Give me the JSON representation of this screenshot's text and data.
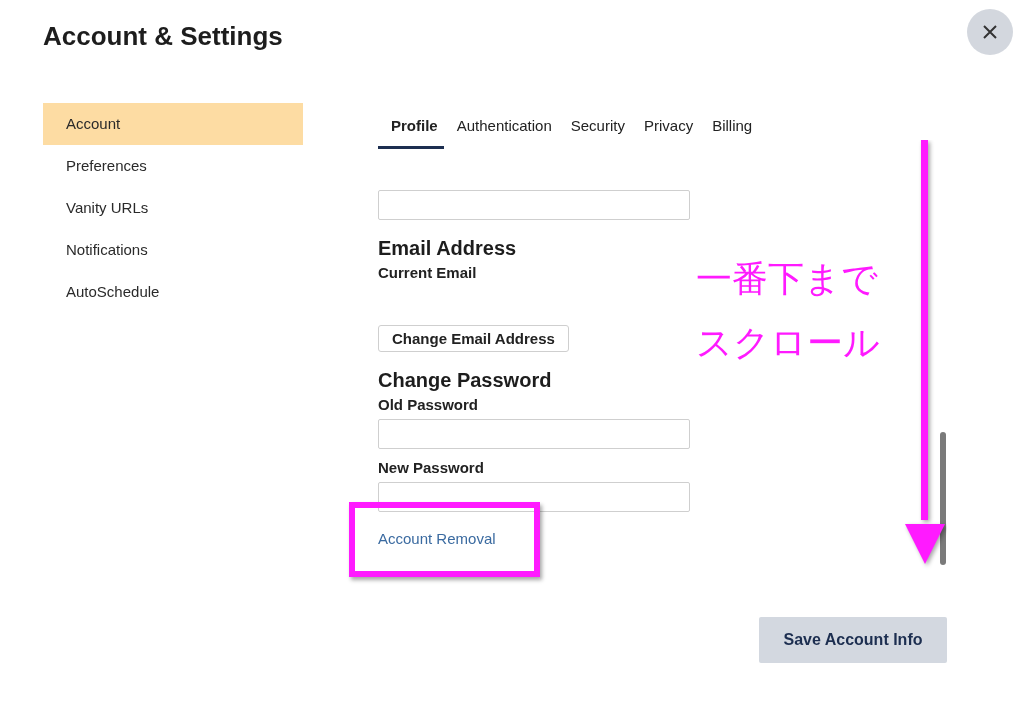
{
  "window": {
    "title": "Account & Settings"
  },
  "sidebar": {
    "items": [
      {
        "label": "Account",
        "selected": true
      },
      {
        "label": "Preferences",
        "selected": false
      },
      {
        "label": "Vanity URLs",
        "selected": false
      },
      {
        "label": "Notifications",
        "selected": false
      },
      {
        "label": "AutoSchedule",
        "selected": false
      }
    ]
  },
  "tabs": [
    {
      "label": "Profile",
      "selected": true
    },
    {
      "label": "Authentication",
      "selected": false
    },
    {
      "label": "Security",
      "selected": false
    },
    {
      "label": "Privacy",
      "selected": false
    },
    {
      "label": "Billing",
      "selected": false
    }
  ],
  "form": [
    {
      "kind": "field"
    },
    {
      "kind": "heading",
      "text": "Email Address"
    },
    {
      "kind": "label",
      "text": "Current Email"
    },
    {
      "kind": "button",
      "text": "Change Email Address"
    },
    {
      "kind": "heading",
      "text": "Change Password"
    },
    {
      "kind": "label",
      "text": "Old Password"
    },
    {
      "kind": "field"
    },
    {
      "kind": "label",
      "text": "New Password"
    },
    {
      "kind": "field"
    },
    {
      "kind": "link",
      "text": "Account Removal"
    }
  ],
  "save_button": "Save Account Info",
  "annotation": {
    "lines": [
      "一番下まで",
      "スクロール"
    ]
  }
}
